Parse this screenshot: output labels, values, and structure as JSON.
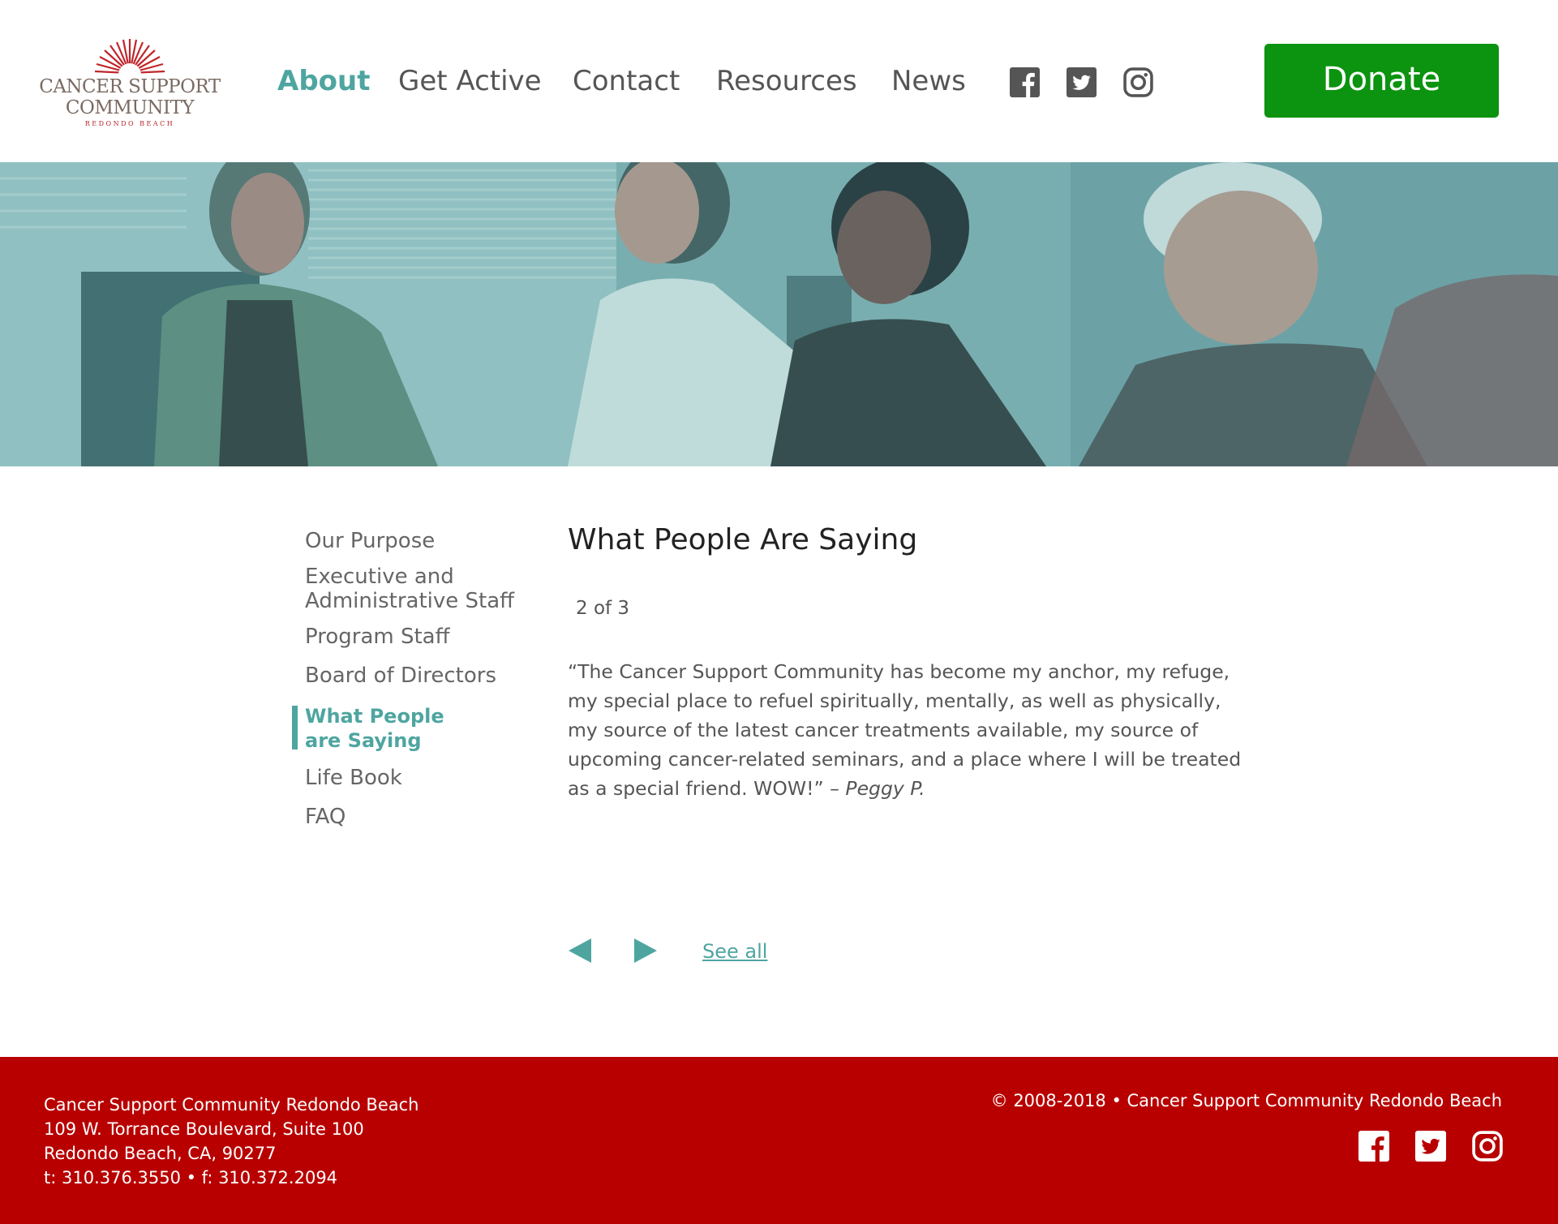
{
  "brand": {
    "logo_line1": "CANCER SUPPORT",
    "logo_line2": "COMMUNITY",
    "logo_line3": "REDONDO BEACH"
  },
  "nav": {
    "items": [
      {
        "label": "About",
        "active": true
      },
      {
        "label": "Get Active",
        "active": false
      },
      {
        "label": "Contact",
        "active": false
      },
      {
        "label": "Resources",
        "active": false
      },
      {
        "label": "News",
        "active": false
      }
    ],
    "social_icons": [
      "facebook-icon",
      "twitter-icon",
      "instagram-icon"
    ],
    "donate_label": "Donate"
  },
  "hero": {
    "image_desc": "photo"
  },
  "sidebar": {
    "items": [
      {
        "label": "Our Purpose"
      },
      {
        "label": "Executive and\nAdministrative Staff"
      },
      {
        "label": "Program Staff"
      },
      {
        "label": "Board of Directors"
      },
      {
        "label": "What People\nare Saying",
        "active": true
      },
      {
        "label": "Life Book"
      },
      {
        "label": "FAQ"
      }
    ]
  },
  "main": {
    "title": "What People Are Saying",
    "counter": "2 of 3",
    "quote_text": "“The Cancer Support Community has become my anchor, my refuge, my special place to refuel spiritually, mentally, as well as physically, my source of the latest cancer treatments available, my source of upcoming cancer-related seminars, and a place where I will be treated as a special friend. WOW!” –",
    "quote_author": "Peggy P.",
    "see_all": "See all"
  },
  "footer": {
    "org_name": "Cancer Support Community Redondo Beach",
    "address1": "109 W. Torrance Boulevard, Suite 100",
    "address2": "Redondo Beach, CA, 90277",
    "phone": "t: 310.376.3550 • f: 310.372.2094",
    "copyright": "© 2008-2018 • Cancer Support Community Redondo Beach"
  },
  "colors": {
    "accent": "#4ea5a0",
    "donate": "#0c9310",
    "footer": "#b80000",
    "logo_red": "#b8262a"
  }
}
